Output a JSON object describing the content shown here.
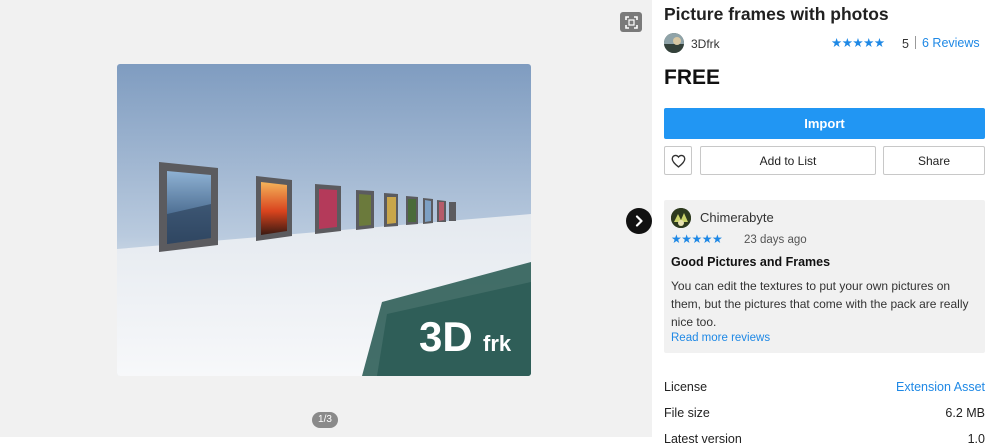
{
  "gallery": {
    "fullscreen_icon": "fullscreen-icon",
    "page_indicator": "1/3",
    "next_icon": "chevron-right-icon",
    "image_logo_text_main": "3D",
    "image_logo_text_sub": "frk"
  },
  "product": {
    "title": "Picture frames with photos",
    "publisher": "3Dfrk",
    "rating_stars": "★★★★★",
    "rating_value": "5",
    "reviews_link": "6 Reviews",
    "price": "FREE"
  },
  "actions": {
    "import_label": "Import",
    "favorite_icon": "heart-icon",
    "add_to_list_label": "Add to List",
    "share_label": "Share"
  },
  "review": {
    "reviewer": "Chimerabyte",
    "stars": "★★★★★",
    "date": "23 days ago",
    "title": "Good Pictures and Frames",
    "body": "You can edit the textures to put your own pictures on them, but the pictures that come with the pack are really nice too.",
    "read_more": "Read more reviews"
  },
  "details": [
    {
      "label": "License",
      "value": "Extension Asset"
    },
    {
      "label": "File size",
      "value": "6.2 MB"
    },
    {
      "label": "Latest version",
      "value": "1.0"
    }
  ],
  "colors": {
    "accent": "#2196f3",
    "link": "#1e88e5",
    "logo_teal": "#2f5e58"
  }
}
